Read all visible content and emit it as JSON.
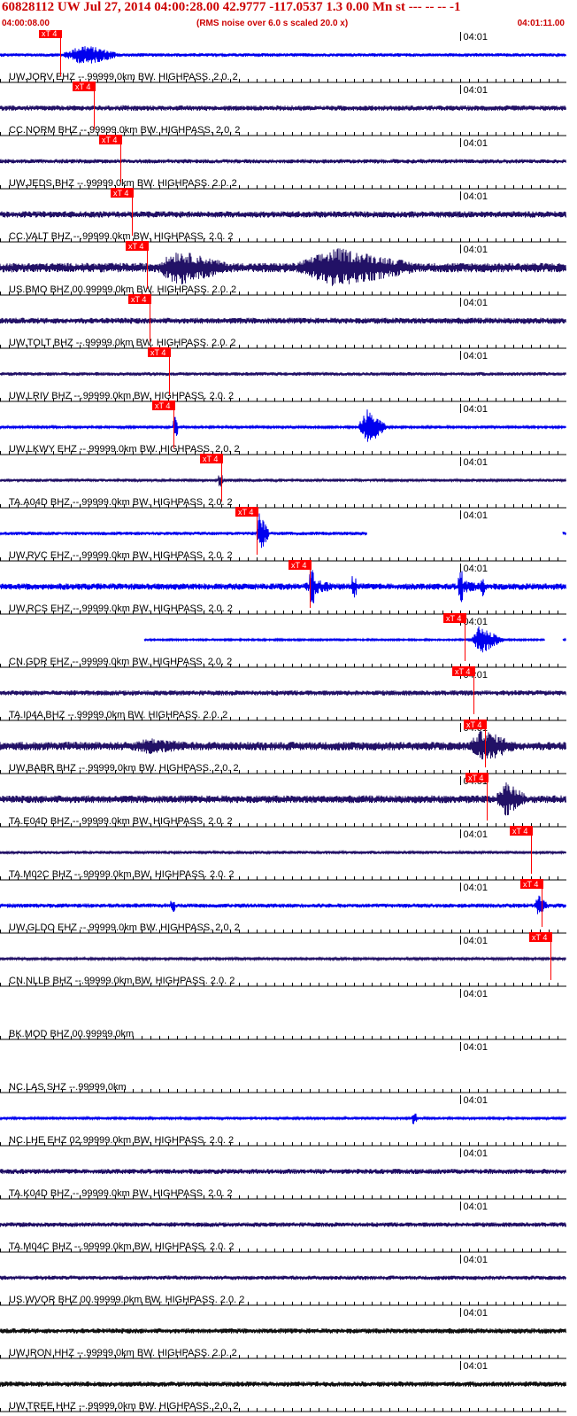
{
  "header": {
    "title": "60828112 UW Jul 27, 2014 04:00:28.00   42.9777 -117.0537  1.3 0.00 Mn st --- -- --   -1",
    "start_time": "04:00:08.00",
    "rms_note": "(RMS noise over 6.0 s scaled 20.0 x)",
    "end_time": "04:01:11.00"
  },
  "chart_data": {
    "type": "line",
    "title": "60828112 UW Jul 27, 2014 04:00:28.00   42.9777 -117.0537  1.3 0.00 Mn st --- -- --   -1",
    "xlabel": "",
    "ylabel": "",
    "x_range": [
      "04:00:08.00",
      "04:01:11.00"
    ],
    "minute_tick_label": "04:01",
    "minute_tick_time_s": 52,
    "pick_label": "xT 4",
    "colors": {
      "header": "#cc0000",
      "pick": "#ff0000",
      "blue": "#0000ee",
      "dark": "#221166",
      "black": "#111111",
      "tick": "#000000"
    },
    "series": [
      {
        "name": "UW.JORV EHZ --.99999.0km BW. HIGHPASS. 2.0. 2",
        "color": "blue",
        "pick_s": 6.8,
        "noise": 0.08,
        "spikes": [],
        "bursts": [
          [
            9.5,
            0.5,
            3,
            5
          ]
        ],
        "gaps": []
      },
      {
        "name": "CC.NORM BHZ --.99999.0km BW. HIGHPASS. 2.0. 2",
        "color": "dark",
        "pick_s": 10.6,
        "noise": 0.12,
        "spikes": [],
        "bursts": [
          [
            14,
            0.15,
            4,
            6
          ]
        ],
        "gaps": []
      },
      {
        "name": "UW.JEDS BHZ --.99999.0km BW. HIGHPASS. 2.0. 2",
        "color": "dark",
        "pick_s": 13.6,
        "noise": 0.1,
        "spikes": [],
        "bursts": [],
        "gaps": []
      },
      {
        "name": "CC.VALT BHZ --.99999.0km BW. HIGHPASS. 2.0. 2",
        "color": "dark",
        "pick_s": 14.9,
        "noise": 0.15,
        "spikes": [],
        "bursts": [
          [
            15.5,
            0.15,
            2,
            4
          ]
        ],
        "gaps": []
      },
      {
        "name": "US.BMO BHZ 00.99999.0km BW. HIGHPASS. 2.0. 2",
        "color": "dark",
        "pick_s": 16.6,
        "noise": 0.22,
        "spikes": [],
        "bursts": [
          [
            20,
            0.85,
            3,
            8
          ],
          [
            38,
            0.95,
            6,
            12
          ]
        ],
        "gaps": []
      },
      {
        "name": "UW.TOLT BHZ --.99999.0km BW. HIGHPASS. 2.0. 2",
        "color": "dark",
        "pick_s": 16.9,
        "noise": 0.14,
        "spikes": [],
        "bursts": [
          [
            17.5,
            0.12,
            3,
            5
          ]
        ],
        "gaps": []
      },
      {
        "name": "UW.LRIV BHZ --.99999.0km BW. HIGHPASS. 2.0. 2",
        "color": "dark",
        "pick_s": 19.1,
        "noise": 0.08,
        "spikes": [],
        "bursts": [],
        "gaps": []
      },
      {
        "name": "UW.LKWY EHZ --.99999.0km BW. HIGHPASS. 2.0. 2",
        "color": "blue",
        "pick_s": 19.6,
        "noise": 0.05,
        "spikes": [
          [
            19.8,
            0.5
          ]
        ],
        "bursts": [
          [
            41.5,
            0.85,
            1.2,
            2.5
          ]
        ],
        "gaps": []
      },
      {
        "name": "TA.A04D BHZ --.99999.0km BW. HIGHPASS. 2.0. 2",
        "color": "dark",
        "pick_s": 25.0,
        "noise": 0.07,
        "spikes": [
          [
            24.9,
            0.3
          ]
        ],
        "bursts": [],
        "gaps": []
      },
      {
        "name": "UW.RVC EHZ --.99999.0km BW. HIGHPASS. 2.0. 2",
        "color": "blue",
        "pick_s": 29.0,
        "noise": 0.08,
        "spikes": [],
        "bursts": [
          [
            29.3,
            1.0,
            0.4,
            1.3
          ]
        ],
        "gaps": [
          [
            41.5,
            63.5
          ]
        ]
      },
      {
        "name": "UW.RCS EHZ --.99999.0km BW. HIGHPASS. 2.0. 2",
        "color": "blue",
        "pick_s": 35.0,
        "noise": 0.15,
        "spikes": [
          [
            35.2,
            0.9
          ],
          [
            40,
            0.55
          ],
          [
            52,
            0.8
          ],
          [
            54.5,
            0.5
          ]
        ],
        "bursts": [
          [
            35.5,
            0.35,
            2,
            4
          ],
          [
            52.5,
            0.3,
            2,
            4
          ]
        ],
        "gaps": []
      },
      {
        "name": "CN.GDR EHZ --.99999.0km BW. HIGHPASS. 2.0. 2",
        "color": "blue",
        "pick_s": 52.5,
        "noise": 0.04,
        "spikes": [],
        "bursts": [
          [
            54.2,
            0.7,
            1,
            3
          ]
        ],
        "gaps": [
          [
            0,
            16.2
          ],
          [
            61.6,
            63.5
          ]
        ]
      },
      {
        "name": "TA.I04A BHZ --.99999.0km BW. HIGHPASS. 2.0. 2",
        "color": "dark",
        "pick_s": 53.5,
        "noise": 0.12,
        "spikes": [],
        "bursts": [
          [
            15,
            0.15,
            1,
            2
          ]
        ],
        "gaps": []
      },
      {
        "name": "UW.BABR BHZ --.99999.0km BW. HIGHPASS. 2.0. 2",
        "color": "dark",
        "pick_s": 54.8,
        "noise": 0.2,
        "spikes": [],
        "bursts": [
          [
            17,
            0.4,
            4,
            8
          ],
          [
            54.5,
            0.8,
            2,
            5
          ]
        ],
        "gaps": []
      },
      {
        "name": "TA.E04D BHZ --.99999.0km BW. HIGHPASS. 2.0. 2",
        "color": "dark",
        "pick_s": 55.0,
        "noise": 0.18,
        "spikes": [],
        "bursts": [
          [
            57.2,
            0.85,
            1.5,
            3
          ]
        ],
        "gaps": []
      },
      {
        "name": "TA.M02C BHZ --.99999.0km BW. HIGHPASS. 2.0. 2",
        "color": "dark",
        "pick_s": 60.0,
        "noise": 0.07,
        "spikes": [],
        "bursts": [],
        "gaps": []
      },
      {
        "name": "UW.GLDO EHZ --.99999.0km BW. HIGHPASS. 2.0. 2",
        "color": "blue",
        "pick_s": 61.2,
        "noise": 0.1,
        "spikes": [
          [
            19.5,
            0.3
          ]
        ],
        "bursts": [
          [
            60.8,
            0.5,
            0.6,
            1.5
          ]
        ],
        "gaps": []
      },
      {
        "name": "CN.NLLB BHZ --.99999.0km BW. HIGHPASS. 2.0. 2",
        "color": "dark",
        "pick_s": 62.2,
        "noise": 0.05,
        "spikes": [],
        "bursts": [],
        "gaps": []
      },
      {
        "name": "BK.MOD BHZ 00.99999.0km",
        "color": "dark",
        "pick_s": null,
        "noise": 0,
        "spikes": [],
        "bursts": [],
        "gaps": [
          [
            0,
            63.5
          ]
        ]
      },
      {
        "name": "NC.LAS SHZ --.99999.0km",
        "color": "dark",
        "pick_s": null,
        "noise": 0,
        "spikes": [],
        "bursts": [],
        "gaps": [
          [
            0,
            63.5
          ]
        ]
      },
      {
        "name": "NC.LHE EHZ 02.99999.0km BW. HIGHPASS. 2.0. 2",
        "color": "blue",
        "pick_s": null,
        "noise": 0.06,
        "spikes": [
          [
            46.8,
            0.3
          ]
        ],
        "bursts": [],
        "gaps": []
      },
      {
        "name": "TA.K04D BHZ --.99999.0km BW. HIGHPASS. 2.0. 2",
        "color": "dark",
        "pick_s": null,
        "noise": 0.12,
        "spikes": [],
        "bursts": [],
        "gaps": []
      },
      {
        "name": "TA.M04C BHZ --.99999.0km BW. HIGHPASS. 2.0. 2",
        "color": "dark",
        "pick_s": null,
        "noise": 0.11,
        "spikes": [],
        "bursts": [],
        "gaps": []
      },
      {
        "name": "US.WVOR BHZ 00.99999.0km BW. HIGHPASS. 2.0. 2",
        "color": "dark",
        "pick_s": null,
        "noise": 0.1,
        "spikes": [],
        "bursts": [],
        "gaps": []
      },
      {
        "name": "UW.IRON HHZ --.99999.0km BW. HIGHPASS. 2.0. 2",
        "color": "black",
        "pick_s": null,
        "noise": 0.12,
        "spikes": [],
        "bursts": [],
        "gaps": []
      },
      {
        "name": "UW.TREE HHZ --.99999.0km BW. HIGHPASS. 2.0. 2",
        "color": "black",
        "pick_s": null,
        "noise": 0.12,
        "spikes": [],
        "bursts": [],
        "gaps": []
      }
    ]
  }
}
